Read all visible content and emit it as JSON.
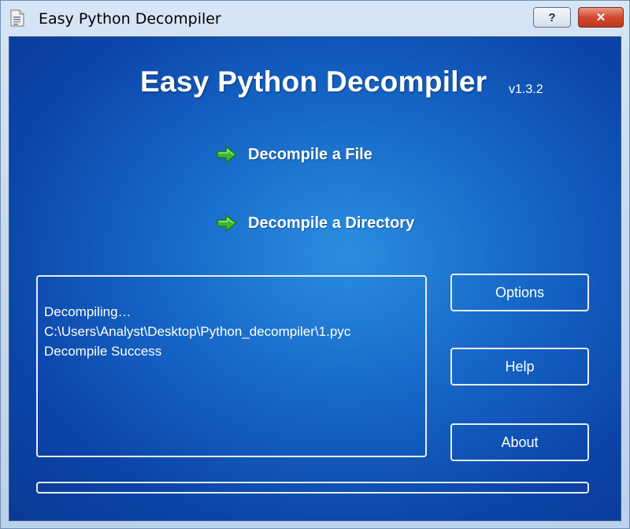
{
  "window": {
    "title": "Easy Python Decompiler",
    "help_button": "?",
    "close_button": "✕"
  },
  "header": {
    "app_title": "Easy Python Decompiler",
    "version": "v1.3.2"
  },
  "actions": [
    {
      "label": "Decompile a File",
      "icon": "green-arrow-icon"
    },
    {
      "label": "Decompile a Directory",
      "icon": "green-arrow-icon"
    }
  ],
  "log": {
    "lines": [
      "Decompiling…",
      "C:\\Users\\Analyst\\Desktop\\Python_decompiler\\1.pyc",
      "Decompile Success"
    ]
  },
  "buttons": {
    "options": "Options",
    "help": "Help",
    "about": "About"
  },
  "progress": {
    "fraction": 0.0
  },
  "colors": {
    "background_center": "#2a8ee0",
    "background_edge": "#0a3a96",
    "arrow_green": "#3cb82e",
    "text": "#ffffff"
  }
}
